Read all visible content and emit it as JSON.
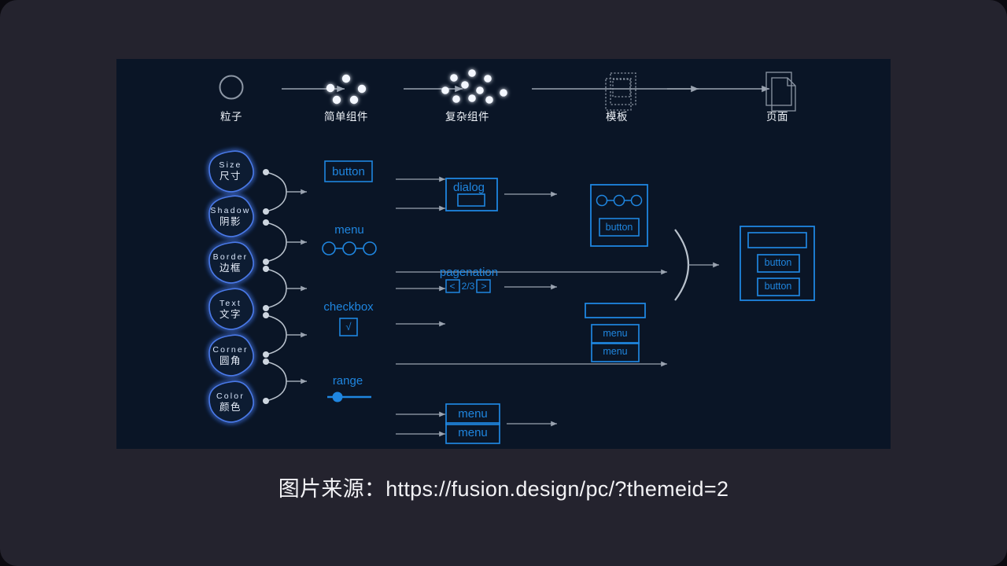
{
  "caption": "图片来源：https://fusion.design/pc/?themeid=2",
  "colors": {
    "outer_bg": "#24232e",
    "canvas_bg": "#0a1526",
    "accent_blue": "#1f86e0",
    "glow_blue": "#3f6fd8",
    "line_gray": "#9aa3b0",
    "text_light": "#eef2f8"
  },
  "pipeline": {
    "steps": [
      {
        "label": "粒子",
        "icon": "circle-outline-icon"
      },
      {
        "label": "简单组件",
        "icon": "five-dots-cluster-icon"
      },
      {
        "label": "复杂组件",
        "icon": "many-dots-cluster-icon"
      },
      {
        "label": "模板",
        "icon": "dashed-frames-icon"
      },
      {
        "label": "页面",
        "icon": "stacked-documents-icon"
      }
    ],
    "arrows": 4
  },
  "tokens": [
    {
      "en": "Size",
      "cn": "尺寸"
    },
    {
      "en": "Shadow",
      "cn": "阴影"
    },
    {
      "en": "Border",
      "cn": "边框"
    },
    {
      "en": "Text",
      "cn": "文字"
    },
    {
      "en": "Corner",
      "cn": "圆角"
    },
    {
      "en": "Color",
      "cn": "颜色"
    }
  ],
  "simple_components": [
    {
      "name": "button",
      "type": "button-box"
    },
    {
      "name": "menu",
      "type": "menu-dots"
    },
    {
      "name": "checkbox",
      "type": "checkbox-box",
      "glyph": "√"
    },
    {
      "name": "range",
      "type": "range-slider"
    }
  ],
  "complex_components": [
    {
      "name": "dialog",
      "type": "dialog-box"
    },
    {
      "name": "pagenation",
      "type": "pagination",
      "prev": "<",
      "page": "2/3",
      "next": ">"
    },
    {
      "name": "menu-list",
      "type": "menu-stack",
      "items": [
        "menu",
        "menu"
      ]
    }
  ],
  "templates": [
    {
      "name": "template-menu-button",
      "parts": [
        "menu-dots",
        "button"
      ]
    },
    {
      "name": "template-bar-menus",
      "parts": [
        "bar",
        "menu",
        "menu"
      ]
    }
  ],
  "page_preview": {
    "name": "page-composite",
    "parts": [
      "header-bar",
      "button",
      "button"
    ]
  }
}
